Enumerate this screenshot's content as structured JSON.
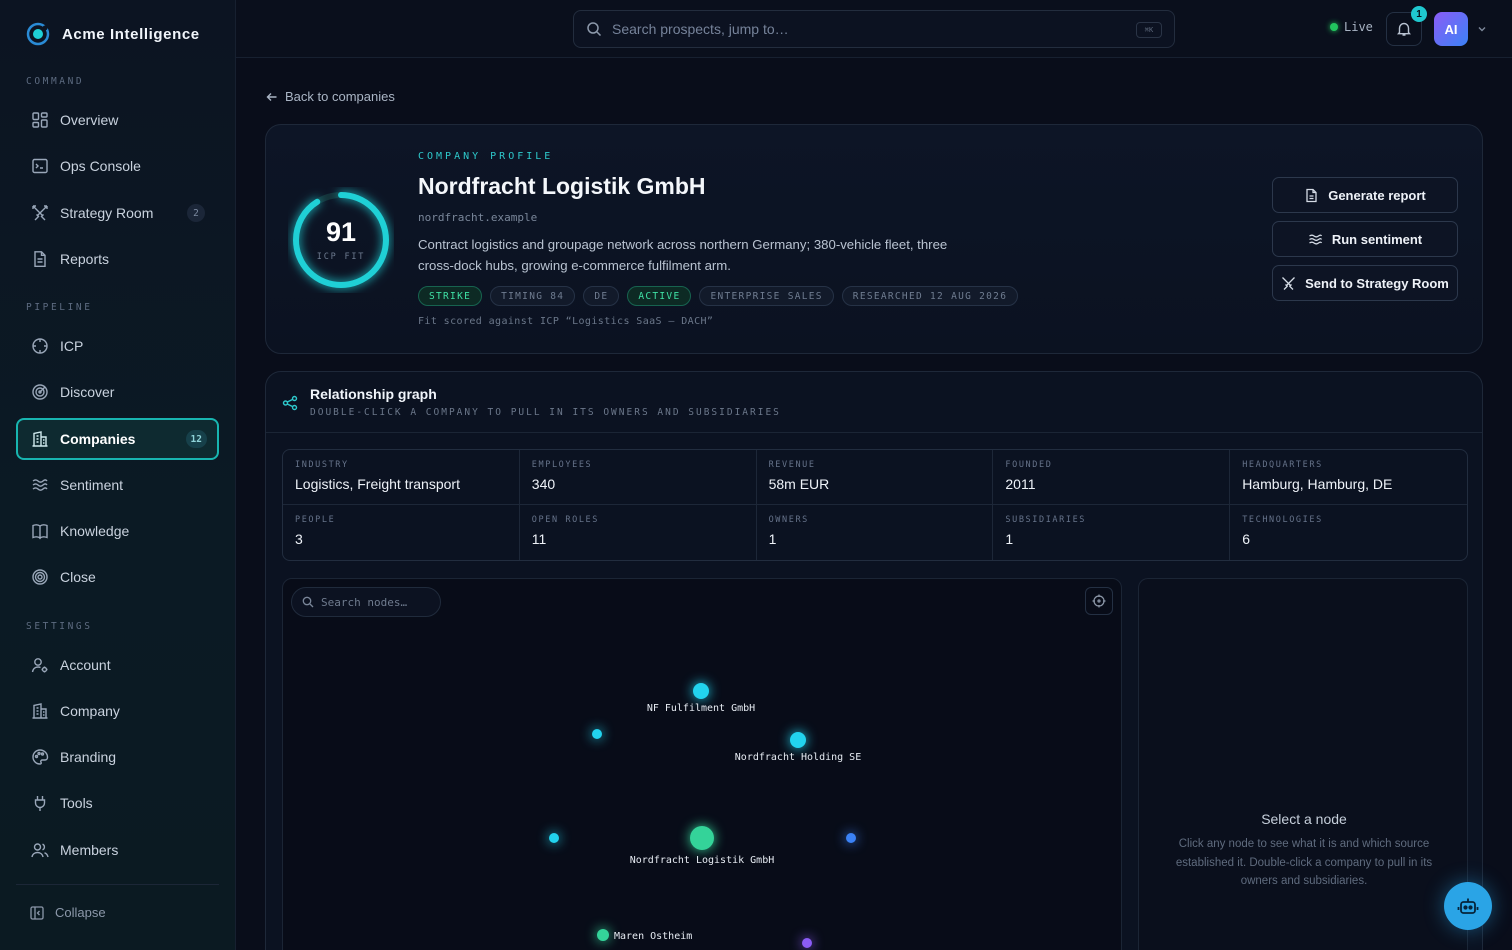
{
  "brand": {
    "name": "Acme Intelligence",
    "logo_icon": "orbit-logo-icon"
  },
  "sidebar": {
    "sections": {
      "command": "COMMAND",
      "pipeline": "PIPELINE",
      "settings": "SETTINGS"
    },
    "items": [
      {
        "label": "Overview",
        "icon": "grid-icon",
        "badge": ""
      },
      {
        "label": "Ops Console",
        "icon": "console-icon",
        "badge": ""
      },
      {
        "label": "Strategy Room",
        "icon": "crossed-swords-icon",
        "badge": "2"
      },
      {
        "label": "Reports",
        "icon": "document-icon",
        "badge": ""
      },
      {
        "label": "ICP",
        "icon": "crosshair-icon",
        "badge": ""
      },
      {
        "label": "Discover",
        "icon": "radar-icon",
        "badge": ""
      },
      {
        "label": "Companies",
        "icon": "building-icon",
        "badge": "12",
        "active": true
      },
      {
        "label": "Sentiment",
        "icon": "waves-icon",
        "badge": ""
      },
      {
        "label": "Knowledge",
        "icon": "book-icon",
        "badge": ""
      },
      {
        "label": "Close",
        "icon": "target-icon",
        "badge": ""
      },
      {
        "label": "Account",
        "icon": "user-settings-icon",
        "badge": ""
      },
      {
        "label": "Company",
        "icon": "building-icon",
        "badge": ""
      },
      {
        "label": "Branding",
        "icon": "palette-icon",
        "badge": ""
      },
      {
        "label": "Tools",
        "icon": "plug-icon",
        "badge": ""
      },
      {
        "label": "Members",
        "icon": "users-icon",
        "badge": ""
      }
    ],
    "collapse_label": "Collapse"
  },
  "topbar": {
    "search_placeholder": "Search prospects, jump to…",
    "shortcut": "⌘K",
    "status": "Live",
    "notification_count": "1",
    "avatar_initials": "AI"
  },
  "back_link": "Back to companies",
  "profile": {
    "eyebrow": "COMPANY PROFILE",
    "name": "Nordfracht Logistik GmbH",
    "domain": "nordfracht.example",
    "description": "Contract logistics and groupage network across northern Germany; 380-vehicle fleet, three cross-dock hubs, growing e-commerce fulfilment arm.",
    "score": "91",
    "score_fraction": 0.91,
    "score_label": "ICP FIT",
    "tags": [
      {
        "label": "STRIKE",
        "style": "green"
      },
      {
        "label": "TIMING 84",
        "style": "muted"
      },
      {
        "label": "DE",
        "style": "muted"
      },
      {
        "label": "ACTIVE",
        "style": "green"
      },
      {
        "label": "ENTERPRISE SALES",
        "style": "muted"
      },
      {
        "label": "RESEARCHED 12 AUG 2026",
        "style": "muted"
      }
    ],
    "fit_note": "Fit scored against ICP “Logistics SaaS — DACH”",
    "actions": {
      "report": "Generate report",
      "sentiment": "Run sentiment",
      "strategy": "Send to Strategy Room"
    }
  },
  "graph": {
    "title": "Relationship graph",
    "subtitle": "DOUBLE-CLICK A COMPANY TO PULL IN ITS OWNERS AND SUBSIDIARIES",
    "search_placeholder": "Search nodes…",
    "stats": [
      {
        "label": "INDUSTRY",
        "value": "Logistics, Freight transport"
      },
      {
        "label": "EMPLOYEES",
        "value": "340"
      },
      {
        "label": "REVENUE",
        "value": "58m EUR"
      },
      {
        "label": "FOUNDED",
        "value": "2011"
      },
      {
        "label": "HEADQUARTERS",
        "value": "Hamburg, Hamburg, DE"
      },
      {
        "label": "PEOPLE",
        "value": "3"
      },
      {
        "label": "OPEN ROLES",
        "value": "11"
      },
      {
        "label": "OWNERS",
        "value": "1"
      },
      {
        "label": "SUBSIDIARIES",
        "value": "1"
      },
      {
        "label": "TECHNOLOGIES",
        "value": "6"
      }
    ],
    "nodes": [
      {
        "label": "NF Fulfilment GmbH",
        "color": "#22d3ee"
      },
      {
        "label": "Nordfracht Holding SE",
        "color": "#22d3ee"
      },
      {
        "label": "Nordfracht Logistik GmbH",
        "color": "#34d399"
      },
      {
        "label": "Maren Ostheim",
        "color": "#34d399"
      },
      {
        "label": "",
        "color": "#22d3ee"
      },
      {
        "label": "",
        "color": "#22d3ee"
      },
      {
        "label": "",
        "color": "#3b82f6"
      },
      {
        "label": "",
        "color": "#8b5cf6"
      }
    ],
    "detail": {
      "title": "Select a node",
      "text": "Click any node to see what it is and which source established it. Double-click a company to pull in its owners and subsidiaries."
    }
  },
  "colors": {
    "accent": "#2ec9cc",
    "active_green": "#3fe0a5",
    "live": "#22c55e"
  }
}
